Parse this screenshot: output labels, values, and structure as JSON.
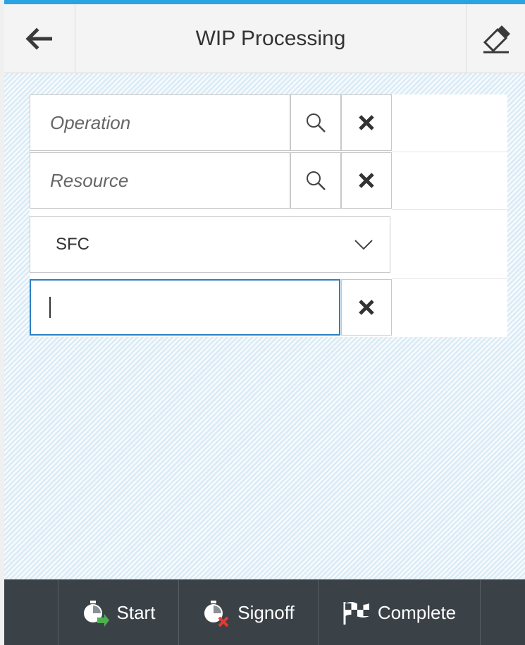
{
  "header": {
    "title": "WIP Processing",
    "back_icon": "arrow-left-icon",
    "erase_icon": "eraser-icon"
  },
  "form": {
    "operation": {
      "placeholder": "Operation",
      "search_icon": "search-icon",
      "clear_icon": "close-icon"
    },
    "resource": {
      "placeholder": "Resource",
      "search_icon": "search-icon",
      "clear_icon": "close-icon"
    },
    "input_type": {
      "selected": "SFC",
      "icon": "chevron-down-icon"
    },
    "sfc_input": {
      "value": "",
      "clear_icon": "close-icon"
    }
  },
  "footer": {
    "buttons": [
      {
        "label": "Start",
        "icon": "start-timer-icon"
      },
      {
        "label": "Signoff",
        "icon": "signoff-timer-icon"
      },
      {
        "label": "Complete",
        "icon": "checkered-flag-icon"
      }
    ]
  },
  "colors": {
    "accent": "#2aa4e0",
    "focus_border": "#2b7fc4",
    "footer_bg": "#3b4247",
    "start_green": "#4caf50",
    "signoff_red": "#e53935"
  }
}
